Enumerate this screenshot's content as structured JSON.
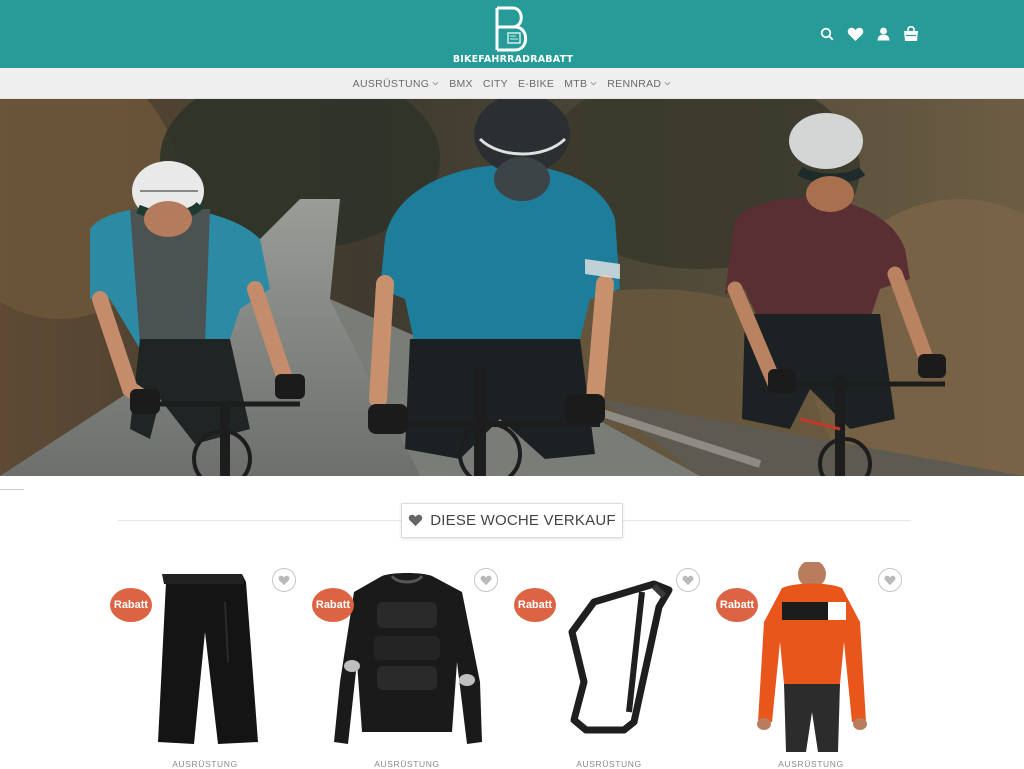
{
  "brand": {
    "name": "BIKEFAHRRADRABATT"
  },
  "header_icons": [
    "search-icon",
    "heart-icon",
    "user-icon",
    "shopping-bag-icon"
  ],
  "nav": {
    "items": [
      {
        "label": "AUSRÜSTUNG",
        "dropdown": true
      },
      {
        "label": "BMX",
        "dropdown": false
      },
      {
        "label": "CITY",
        "dropdown": false
      },
      {
        "label": "E-BIKE",
        "dropdown": false
      },
      {
        "label": "MTB",
        "dropdown": true
      },
      {
        "label": "RENNRAD",
        "dropdown": true
      }
    ]
  },
  "section": {
    "title": "DIESE WOCHE VERKAUF"
  },
  "products": [
    {
      "badge": "Rabatt",
      "category": "AUSRÜSTUNG",
      "image": "black-cycling-shorts"
    },
    {
      "badge": "Rabatt",
      "category": "AUSRÜSTUNG",
      "image": "black-protector-jacket"
    },
    {
      "badge": "Rabatt",
      "category": "AUSRÜSTUNG",
      "image": "black-bottle-cage"
    },
    {
      "badge": "Rabatt",
      "category": "AUSRÜSTUNG",
      "image": "orange-cycling-jersey"
    }
  ],
  "colors": {
    "header": "#279b98",
    "nav_bg": "#efefef",
    "badge": "#dc6444"
  }
}
